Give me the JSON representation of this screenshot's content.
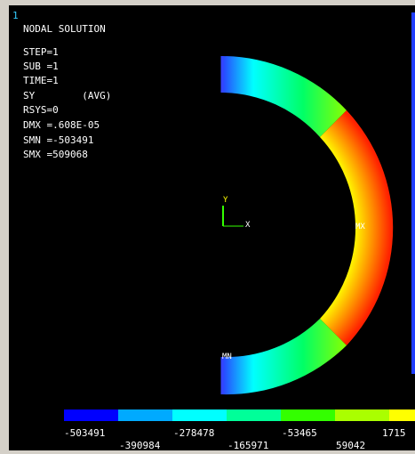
{
  "window_number": "1",
  "info": {
    "title": "NODAL SOLUTION",
    "step": "STEP=1",
    "sub": "SUB =1",
    "time": "TIME=1",
    "result": "SY        (AVG)",
    "rsys": "RSYS=0",
    "dmx": "DMX =.608E-05",
    "smn": "SMN =-503491",
    "smx": "SMX =509068"
  },
  "markers": {
    "max": "MX",
    "min": "MN"
  },
  "triad": {
    "y": "Y",
    "x": "X"
  },
  "colors": {
    "background": "#000000",
    "legend": [
      "#0000ff",
      "#00aaff",
      "#00ffff",
      "#00ff99",
      "#33ff00",
      "#aaff00",
      "#ffff00"
    ]
  },
  "legend": {
    "labels_top": [
      "-503491",
      "-278478",
      "-53465",
      "1715"
    ],
    "labels_bottom": [
      "-390984",
      "-165971",
      "59042"
    ]
  }
}
